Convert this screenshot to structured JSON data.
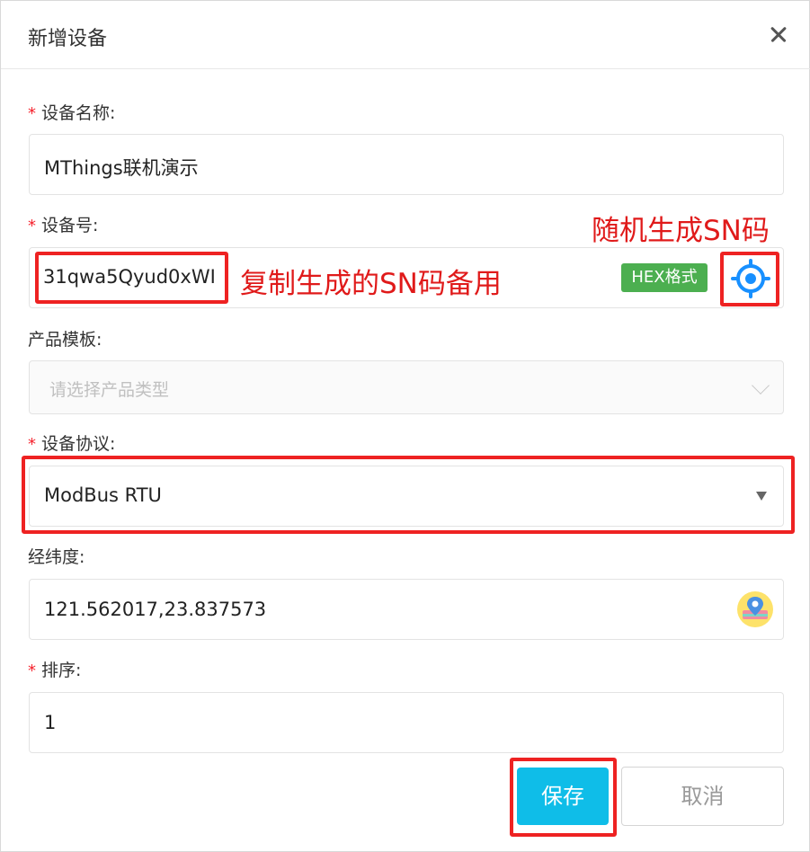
{
  "dialog": {
    "title": "新增设备",
    "close_icon": "close-icon"
  },
  "fields": {
    "device_name": {
      "label": "设备名称:",
      "required": true,
      "value": "MThings联机演示"
    },
    "device_sn": {
      "label": "设备号:",
      "required": true,
      "value": "31qwa5Qyud0xWI",
      "hex_badge": "HEX格式",
      "generate_icon": "target-icon"
    },
    "product_template": {
      "label": "产品模板:",
      "required": false,
      "placeholder": "请选择产品类型"
    },
    "protocol": {
      "label": "设备协议:",
      "required": true,
      "value": "ModBus RTU"
    },
    "lat_lng": {
      "label": "经纬度:",
      "required": false,
      "value": "121.562017,23.837573",
      "map_icon": "map-pin-icon"
    },
    "sort": {
      "label": "排序:",
      "required": true,
      "value": "1"
    }
  },
  "required_mark": "*",
  "annotations": {
    "random_sn": "随机生成SN码",
    "copy_sn": "复制生成的SN码备用"
  },
  "buttons": {
    "save": "保存",
    "cancel": "取消"
  },
  "colors": {
    "primary": "#0fbde8",
    "annotation_red": "#e01a1a",
    "hex_green": "#4caf50",
    "required_red": "#f5222d"
  }
}
